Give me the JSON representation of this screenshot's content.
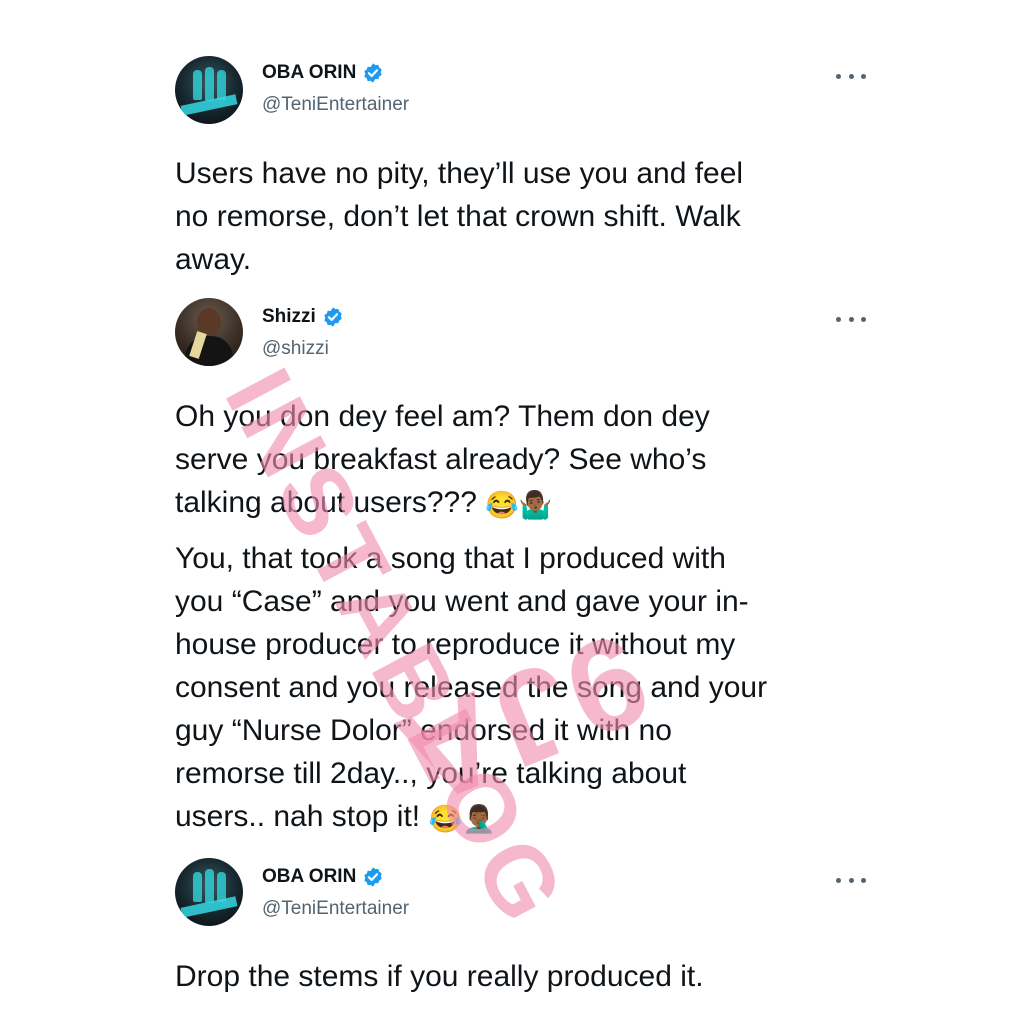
{
  "tweets": [
    {
      "name": "OBA ORIN",
      "handle": "@TeniEntertainer",
      "text": "Users have no pity, they’ll use you and feel\nno remorse, don’t let that crown shift. Walk\naway."
    },
    {
      "name": "Shizzi",
      "handle": "@shizzi",
      "text1": "Oh you don dey feel am? Them don dey\nserve you breakfast already? See who’s\ntalking about users??? ",
      "emoji1": "😂🤷🏾‍♂️",
      "text2": "You, that took a song that I produced with\nyou “Case” and you went and gave your in-\nhouse producer to reproduce it without my\nconsent and you released the song and your\nguy “Nurse Dolor” endorsed it with no\nremorse till 2day.., you’re talking about\nusers.. nah stop it! ",
      "emoji2": "😂🤦🏾‍♂️"
    },
    {
      "name": "OBA ORIN",
      "handle": "@TeniEntertainer",
      "text": "Drop the stems if you really produced it."
    }
  ],
  "watermark": {
    "line1": "INSTABLOG",
    "line2": "9JA"
  },
  "colors": {
    "verified": "#1d9bf0",
    "handle": "#536471",
    "watermark": "#f08caf"
  },
  "icons": [
    "verified-badge-icon",
    "more-options-icon"
  ]
}
